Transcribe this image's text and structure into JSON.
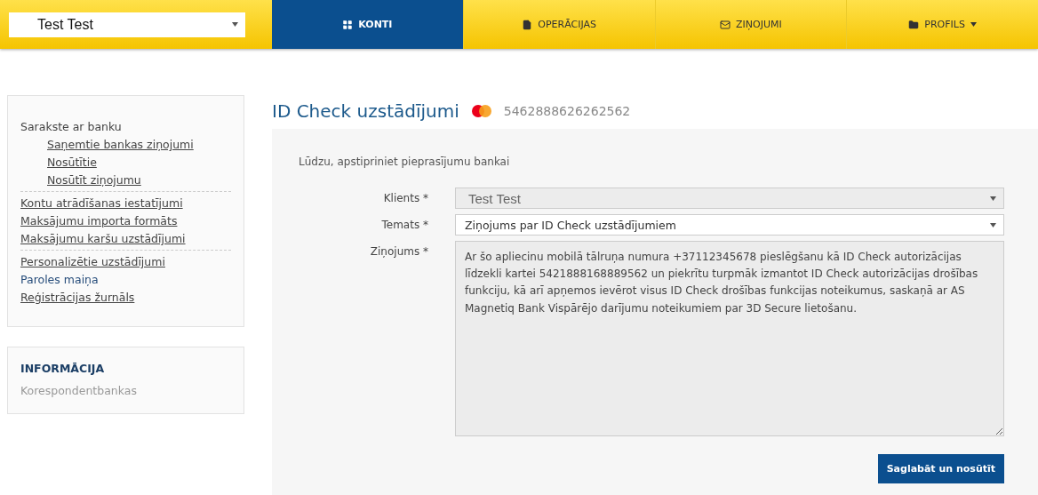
{
  "client_select": {
    "value": "Test Test"
  },
  "nav": [
    {
      "label": "KONTI",
      "kind": "grid",
      "selected": true,
      "dropdown": false
    },
    {
      "label": "OPERĀCIJAS",
      "kind": "file",
      "selected": false,
      "dropdown": false
    },
    {
      "label": "ZIŅOJUMI",
      "kind": "mail",
      "selected": false,
      "dropdown": false
    },
    {
      "label": "PROFILS",
      "kind": "folder",
      "selected": false,
      "dropdown": true
    }
  ],
  "sidebar": {
    "groups": [
      [
        {
          "label": "Sarakste ar banku",
          "kind": "heading",
          "children": [
            {
              "label": "Saņemtie bankas ziņojumi",
              "kind": "link"
            },
            {
              "label": "Nosūtītie",
              "kind": "link"
            },
            {
              "label": "Nosūtīt ziņojumu",
              "kind": "link"
            }
          ]
        }
      ],
      [
        {
          "label": "Kontu atrādīšanas iestatījumi",
          "kind": "link"
        },
        {
          "label": "Maksājumu importa formāts",
          "kind": "link"
        },
        {
          "label": "Maksājumu karšu uzstādījumi",
          "kind": "link"
        }
      ],
      [
        {
          "label": "Personalizētie uzstādījumi",
          "kind": "link"
        },
        {
          "label": "Paroles maiņa",
          "kind": "current"
        },
        {
          "label": "Reģistrācijas žurnāls",
          "kind": "link"
        }
      ]
    ]
  },
  "info": {
    "title": "INFORMĀCIJA",
    "items": [
      "Korespondentbankas"
    ]
  },
  "page": {
    "title": "ID Check uzstādījumi",
    "card_number": "5462888626262562"
  },
  "form": {
    "intro": "Lūdzu, apstipriniet pieprasījumu bankai",
    "fields": [
      {
        "label": "Klients *",
        "kind": "select",
        "value": "Test Test",
        "disabled": true
      },
      {
        "label": "Temats *",
        "kind": "select",
        "value": "Ziņojums par ID Check uzstādījumiem",
        "disabled": false
      },
      {
        "label": "Ziņojums *",
        "kind": "textarea",
        "value": "Ar šo apliecinu mobilā tālruņa numura +37112345678 pieslēgšanu kā ID Check autorizācijas līdzekli kartei 5421888168889562 un piekrītu turpmāk izmantot ID Check autorizācijas drošības funkciju, kā arī apņemos ievērot visus ID Check drošības funkcijas noteikumus, saskaņā ar AS Magnetiq Bank Vispārējo darījumu noteikumiem par 3D Secure lietošanu.",
        "disabled": true
      }
    ],
    "submit": "Saglabāt un nosūtīt"
  }
}
